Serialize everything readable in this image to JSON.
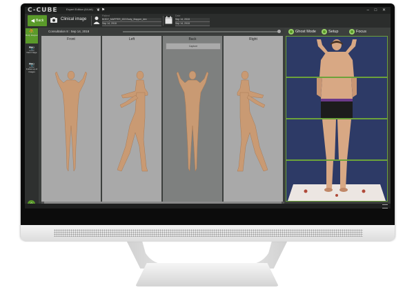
{
  "app": {
    "logo": "C-CUBE",
    "edition": "Expert Edition  (64-bit)",
    "window_controls": "– □ ✕"
  },
  "toolbar": {
    "back_label": "Back",
    "section_title": "Clinical image",
    "patient_label": "Patient",
    "patient_value": "BODY_MAPPER_633 Body_Mapper_dev",
    "patient_date_value": "Sep 14, 2018",
    "date_label": "Date",
    "date_value": "Sep 14, 2018",
    "date2_value": "Sep 14, 2018"
  },
  "sidebar": {
    "items": [
      {
        "label": "Body Mapper",
        "icon": "person-icon"
      },
      {
        "label": "New image",
        "icon": "camera-icon"
      },
      {
        "label": "Follow up of images",
        "icon": "camera-icon"
      }
    ]
  },
  "consultation": {
    "label": "Consultation  8  :  Sep 14, 2018"
  },
  "toggles": {
    "ghost_mode": "Ghost Mode",
    "setup": "Setup",
    "focus": "Focus"
  },
  "views": [
    {
      "title": "Front"
    },
    {
      "title": "Left"
    },
    {
      "title": "Back",
      "button": "Capture"
    },
    {
      "title": "Right"
    }
  ],
  "colors": {
    "accent": "#5a9a2a",
    "panel": "#a9a9a9",
    "screen_bg": "#3c3f3d"
  }
}
